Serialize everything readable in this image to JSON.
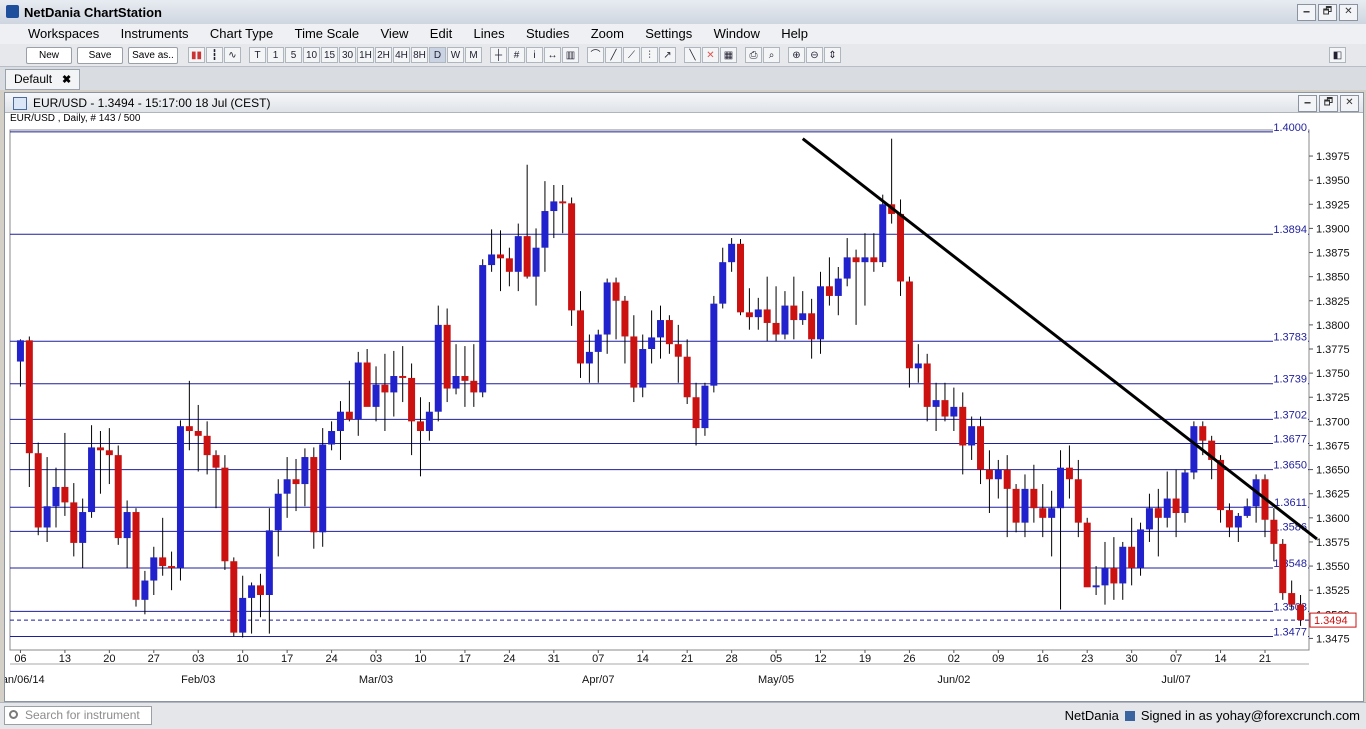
{
  "app": {
    "title": "NetDania ChartStation"
  },
  "window_buttons": [
    "🗕",
    "🗗",
    "✕"
  ],
  "menu": [
    "Workspaces",
    "Instruments",
    "Chart Type",
    "Time Scale",
    "View",
    "Edit",
    "Lines",
    "Studies",
    "Zoom",
    "Settings",
    "Window",
    "Help"
  ],
  "toolbar": {
    "new_label": "New",
    "save_label": "Save",
    "saveas_label": "Save as..",
    "timescale_buttons": [
      "T",
      "1",
      "5",
      "10",
      "15",
      "30",
      "1H",
      "2H",
      "4H",
      "8H",
      "D",
      "W",
      "M"
    ]
  },
  "tabs": [
    {
      "label": "Default",
      "close": "✖"
    }
  ],
  "chart_window": {
    "title": "EUR/USD - 1.3494 - 15:17:00  18 Jul (CEST)",
    "subtitle": "EUR/USD , Daily, # 143 / 500"
  },
  "chart_data": {
    "type": "candlestick",
    "instrument": "EUR/USD",
    "timeframe": "Daily",
    "ylim": [
      1.3463,
      1.4002
    ],
    "y_ticks": [
      1.3475,
      1.35,
      1.3525,
      1.355,
      1.3575,
      1.36,
      1.3625,
      1.365,
      1.3675,
      1.37,
      1.3725,
      1.375,
      1.3775,
      1.38,
      1.3825,
      1.385,
      1.3875,
      1.39,
      1.3925,
      1.395,
      1.3975
    ],
    "y_tick_labels": [
      "1.3475",
      "1.3500",
      "1.3525",
      "1.3550",
      "1.3575",
      "1.3600",
      "1.3625",
      "1.3650",
      "1.3675",
      "1.3700",
      "1.3725",
      "1.3750",
      "1.3775",
      "1.3800",
      "1.3825",
      "1.3850",
      "1.3875",
      "1.3900",
      "1.3925",
      "1.3950",
      "1.3975"
    ],
    "x_tick_labels": [
      "06",
      "13",
      "20",
      "27",
      "03",
      "10",
      "17",
      "24",
      "03",
      "10",
      "17",
      "24",
      "31",
      "07",
      "14",
      "21",
      "28",
      "05",
      "12",
      "19",
      "26",
      "02",
      "09",
      "16",
      "23",
      "30",
      "07",
      "14",
      "21"
    ],
    "month_labels": [
      {
        "label": "Jan/06/14",
        "week_index": 0
      },
      {
        "label": "Feb/03",
        "week_index": 4
      },
      {
        "label": "Mar/03",
        "week_index": 8
      },
      {
        "label": "Apr/07",
        "week_index": 13
      },
      {
        "label": "May/05",
        "week_index": 17
      },
      {
        "label": "Jun/02",
        "week_index": 21
      },
      {
        "label": "Jul/07",
        "week_index": 26
      }
    ],
    "horizontal_levels": [
      {
        "value": 1.4,
        "label": "1.4000"
      },
      {
        "value": 1.3894,
        "label": "1.3894"
      },
      {
        "value": 1.3783,
        "label": "1.3783"
      },
      {
        "value": 1.3739,
        "label": "1.3739"
      },
      {
        "value": 1.3702,
        "label": "1.3702"
      },
      {
        "value": 1.3677,
        "label": "1.3677"
      },
      {
        "value": 1.365,
        "label": "1.3650"
      },
      {
        "value": 1.3611,
        "label": "1.3611"
      },
      {
        "value": 1.3586,
        "label": "1.3586"
      },
      {
        "value": 1.3548,
        "label": "1.3548"
      },
      {
        "value": 1.3503,
        "label": "1.3503"
      },
      {
        "value": 1.3477,
        "label": "1.3477"
      }
    ],
    "current_price": {
      "value": 1.3494,
      "label": "1.3494"
    },
    "trendline": {
      "from": {
        "day": "2014-05-08",
        "value": 1.3993
      },
      "to": {
        "day": "2014-07-21",
        "value": 1.3578
      }
    },
    "up_color": "#2222cc",
    "down_color": "#cc1111",
    "candles": [
      [
        "Jan 06",
        1.3762,
        1.3785,
        1.3736,
        1.3784
      ],
      [
        "Jan 07",
        1.3784,
        1.3788,
        1.3632,
        1.3667
      ],
      [
        "Jan 08",
        1.3667,
        1.3678,
        1.3582,
        1.359
      ],
      [
        "Jan 09",
        1.359,
        1.3663,
        1.3575,
        1.3612
      ],
      [
        "Jan 10",
        1.3612,
        1.3652,
        1.359,
        1.3632
      ],
      [
        "Jan 13",
        1.3632,
        1.3688,
        1.3602,
        1.3616
      ],
      [
        "Jan 14",
        1.3616,
        1.3636,
        1.356,
        1.3574
      ],
      [
        "Jan 15",
        1.3574,
        1.362,
        1.3548,
        1.3606
      ],
      [
        "Jan 16",
        1.3606,
        1.3696,
        1.36,
        1.3673
      ],
      [
        "Jan 17",
        1.3673,
        1.369,
        1.3625,
        1.367
      ],
      [
        "Jan 20",
        1.367,
        1.3693,
        1.3635,
        1.3665
      ],
      [
        "Jan 21",
        1.3665,
        1.3675,
        1.3572,
        1.3579
      ],
      [
        "Jan 22",
        1.3579,
        1.3618,
        1.3548,
        1.3606
      ],
      [
        "Jan 23",
        1.3606,
        1.361,
        1.3508,
        1.3515
      ],
      [
        "Jan 24",
        1.3515,
        1.3545,
        1.35,
        1.3535
      ],
      [
        "Jan 27",
        1.3535,
        1.357,
        1.352,
        1.3559
      ],
      [
        "Jan 28",
        1.3559,
        1.36,
        1.354,
        1.355
      ],
      [
        "Jan 29",
        1.355,
        1.3565,
        1.3525,
        1.3548
      ],
      [
        "Jan 30",
        1.3548,
        1.3701,
        1.3535,
        1.3695
      ],
      [
        "Jan 31",
        1.3695,
        1.3742,
        1.367,
        1.369
      ],
      [
        "Feb 03",
        1.369,
        1.3717,
        1.3648,
        1.3685
      ],
      [
        "Feb 04",
        1.3685,
        1.37,
        1.3645,
        1.3665
      ],
      [
        "Feb 05",
        1.3665,
        1.367,
        1.361,
        1.3652
      ],
      [
        "Feb 06",
        1.3652,
        1.3665,
        1.3546,
        1.3555
      ],
      [
        "Feb 07",
        1.3555,
        1.3559,
        1.3477,
        1.3481
      ],
      [
        "Feb 10",
        1.3481,
        1.354,
        1.3476,
        1.3517
      ],
      [
        "Feb 11",
        1.3517,
        1.3533,
        1.348,
        1.353
      ],
      [
        "Feb 12",
        1.353,
        1.3542,
        1.3497,
        1.352
      ],
      [
        "Feb 13",
        1.352,
        1.361,
        1.348,
        1.3587
      ],
      [
        "Feb 14",
        1.3587,
        1.364,
        1.356,
        1.3625
      ],
      [
        "Feb 17",
        1.3625,
        1.3663,
        1.36,
        1.364
      ],
      [
        "Feb 18",
        1.364,
        1.3661,
        1.3607,
        1.3635
      ],
      [
        "Feb 19",
        1.3635,
        1.3672,
        1.3612,
        1.3663
      ],
      [
        "Feb 20",
        1.3663,
        1.3673,
        1.3568,
        1.3585
      ],
      [
        "Feb 21",
        1.3585,
        1.3693,
        1.357,
        1.3676
      ],
      [
        "Feb 24",
        1.3676,
        1.37,
        1.367,
        1.369
      ],
      [
        "Feb 25",
        1.369,
        1.3721,
        1.366,
        1.371
      ],
      [
        "Feb 26",
        1.371,
        1.3742,
        1.37,
        1.3702
      ],
      [
        "Feb 27",
        1.3702,
        1.3772,
        1.3685,
        1.3761
      ],
      [
        "Feb 28",
        1.3761,
        1.3775,
        1.3718,
        1.3715
      ],
      [
        "Mar 03",
        1.3715,
        1.3757,
        1.37,
        1.3738
      ],
      [
        "Mar 04",
        1.3738,
        1.377,
        1.369,
        1.373
      ],
      [
        "Mar 05",
        1.373,
        1.3773,
        1.3705,
        1.3747
      ],
      [
        "Mar 06",
        1.3747,
        1.3778,
        1.372,
        1.3745
      ],
      [
        "Mar 07",
        1.3745,
        1.376,
        1.3665,
        1.37
      ],
      [
        "Mar 10",
        1.37,
        1.3725,
        1.3643,
        1.369
      ],
      [
        "Mar 11",
        1.369,
        1.372,
        1.368,
        1.371
      ],
      [
        "Mar 12",
        1.371,
        1.382,
        1.37,
        1.38
      ],
      [
        "Mar 13",
        1.38,
        1.3817,
        1.372,
        1.3734
      ],
      [
        "Mar 14",
        1.3734,
        1.378,
        1.3728,
        1.3747
      ],
      [
        "Mar 17",
        1.3747,
        1.3778,
        1.3715,
        1.3742
      ],
      [
        "Mar 18",
        1.3742,
        1.378,
        1.3715,
        1.373
      ],
      [
        "Mar 19",
        1.373,
        1.3868,
        1.3725,
        1.3862
      ],
      [
        "Mar 20",
        1.3862,
        1.3899,
        1.3855,
        1.3873
      ],
      [
        "Mar 21",
        1.3873,
        1.3898,
        1.3835,
        1.3869
      ],
      [
        "Mar 24",
        1.3869,
        1.388,
        1.384,
        1.3855
      ],
      [
        "Mar 25",
        1.3855,
        1.3905,
        1.3835,
        1.3892
      ],
      [
        "Mar 26",
        1.3892,
        1.3966,
        1.3848,
        1.385
      ],
      [
        "Mar 27",
        1.385,
        1.39,
        1.382,
        1.388
      ],
      [
        "Mar 28",
        1.388,
        1.3949,
        1.3855,
        1.3918
      ],
      [
        "Mar 31",
        1.3918,
        1.3945,
        1.389,
        1.3928
      ],
      [
        "Apr 01",
        1.3928,
        1.3945,
        1.3895,
        1.3926
      ],
      [
        "Apr 02",
        1.3926,
        1.3932,
        1.3799,
        1.3815
      ],
      [
        "Apr 03",
        1.3815,
        1.3835,
        1.3745,
        1.376
      ],
      [
        "Apr 04",
        1.376,
        1.379,
        1.374,
        1.3772
      ],
      [
        "Apr 07",
        1.3772,
        1.3795,
        1.374,
        1.379
      ],
      [
        "Apr 08",
        1.379,
        1.3848,
        1.377,
        1.3844
      ],
      [
        "Apr 09",
        1.3844,
        1.3849,
        1.3785,
        1.3825
      ],
      [
        "Apr 10",
        1.3825,
        1.383,
        1.376,
        1.3788
      ],
      [
        "Apr 11",
        1.3788,
        1.381,
        1.372,
        1.3735
      ],
      [
        "Apr 14",
        1.3735,
        1.379,
        1.3725,
        1.3775
      ],
      [
        "Apr 15",
        1.3775,
        1.3815,
        1.376,
        1.3787
      ],
      [
        "Apr 16",
        1.3787,
        1.382,
        1.3765,
        1.3805
      ],
      [
        "Apr 17",
        1.3805,
        1.381,
        1.377,
        1.378
      ],
      [
        "Apr 18",
        1.378,
        1.38,
        1.374,
        1.3767
      ],
      [
        "Apr 21",
        1.3767,
        1.3785,
        1.3718,
        1.3725
      ],
      [
        "Apr 22",
        1.3725,
        1.374,
        1.3675,
        1.3693
      ],
      [
        "Apr 23",
        1.3693,
        1.374,
        1.3685,
        1.3737
      ],
      [
        "Apr 24",
        1.3737,
        1.383,
        1.373,
        1.3822
      ],
      [
        "Apr 25",
        1.3822,
        1.388,
        1.3817,
        1.3865
      ],
      [
        "Apr 28",
        1.3865,
        1.389,
        1.3855,
        1.3884
      ],
      [
        "Apr 29",
        1.3884,
        1.3889,
        1.381,
        1.3813
      ],
      [
        "Apr 30",
        1.3813,
        1.3838,
        1.3795,
        1.3808
      ],
      [
        "May 01",
        1.3808,
        1.3828,
        1.3795,
        1.3816
      ],
      [
        "May 02",
        1.3816,
        1.385,
        1.3783,
        1.3802
      ],
      [
        "May 05",
        1.3802,
        1.384,
        1.3783,
        1.379
      ],
      [
        "May 06",
        1.379,
        1.3835,
        1.3785,
        1.382
      ],
      [
        "May 07",
        1.382,
        1.385,
        1.3785,
        1.3805
      ],
      [
        "May 08",
        1.3805,
        1.3835,
        1.38,
        1.3812
      ],
      [
        "May 09",
        1.3812,
        1.3827,
        1.3765,
        1.3785
      ],
      [
        "May 12",
        1.3785,
        1.3855,
        1.377,
        1.384
      ],
      [
        "May 13",
        1.384,
        1.387,
        1.382,
        1.383
      ],
      [
        "May 14",
        1.383,
        1.386,
        1.381,
        1.3848
      ],
      [
        "May 15",
        1.3848,
        1.389,
        1.384,
        1.387
      ],
      [
        "May 16",
        1.387,
        1.3878,
        1.38,
        1.3865
      ],
      [
        "May 19",
        1.3865,
        1.3895,
        1.382,
        1.387
      ],
      [
        "May 20",
        1.387,
        1.3895,
        1.3855,
        1.3865
      ],
      [
        "May 21",
        1.3865,
        1.3935,
        1.386,
        1.3925
      ],
      [
        "May 22",
        1.3925,
        1.3993,
        1.3905,
        1.3915
      ],
      [
        "May 23",
        1.3915,
        1.393,
        1.383,
        1.3845
      ],
      [
        "May 26",
        1.3845,
        1.385,
        1.3735,
        1.3755
      ],
      [
        "May 27",
        1.3755,
        1.378,
        1.374,
        1.376
      ],
      [
        "May 28",
        1.376,
        1.377,
        1.37,
        1.3715
      ],
      [
        "May 29",
        1.3715,
        1.374,
        1.369,
        1.3722
      ],
      [
        "May 30",
        1.3722,
        1.374,
        1.37,
        1.3705
      ],
      [
        "Jun 02",
        1.3705,
        1.3735,
        1.369,
        1.3715
      ],
      [
        "Jun 03",
        1.3715,
        1.373,
        1.3645,
        1.3675
      ],
      [
        "Jun 04",
        1.3675,
        1.3705,
        1.366,
        1.3695
      ],
      [
        "Jun 05",
        1.3695,
        1.3705,
        1.3635,
        1.365
      ],
      [
        "Jun 06",
        1.365,
        1.367,
        1.3605,
        1.364
      ],
      [
        "Jun 09",
        1.364,
        1.366,
        1.362,
        1.365
      ],
      [
        "Jun 10",
        1.365,
        1.3665,
        1.358,
        1.363
      ],
      [
        "Jun 11",
        1.363,
        1.3635,
        1.3585,
        1.3595
      ],
      [
        "Jun 12",
        1.3595,
        1.3645,
        1.358,
        1.363
      ],
      [
        "Jun 13",
        1.363,
        1.3655,
        1.3595,
        1.361
      ],
      [
        "Jun 16",
        1.361,
        1.3635,
        1.358,
        1.36
      ],
      [
        "Jun 17",
        1.36,
        1.3628,
        1.356,
        1.361
      ],
      [
        "Jun 18",
        1.361,
        1.367,
        1.3505,
        1.3652
      ],
      [
        "Jun 19",
        1.3652,
        1.3675,
        1.362,
        1.364
      ],
      [
        "Jun 20",
        1.364,
        1.366,
        1.358,
        1.3595
      ],
      [
        "Jun 23",
        1.3595,
        1.36,
        1.354,
        1.3528
      ],
      [
        "Jun 24",
        1.3528,
        1.355,
        1.352,
        1.353
      ],
      [
        "Jun 25",
        1.353,
        1.3575,
        1.351,
        1.3548
      ],
      [
        "Jun 26",
        1.3548,
        1.358,
        1.3515,
        1.3532
      ],
      [
        "Jun 27",
        1.3532,
        1.3575,
        1.3515,
        1.357
      ],
      [
        "Jun 30",
        1.357,
        1.36,
        1.353,
        1.3548
      ],
      [
        "Jul 01",
        1.3548,
        1.3595,
        1.354,
        1.3588
      ],
      [
        "Jul 02",
        1.3588,
        1.3625,
        1.3575,
        1.361
      ],
      [
        "Jul 03",
        1.361,
        1.363,
        1.356,
        1.36
      ],
      [
        "Jul 04",
        1.36,
        1.3648,
        1.359,
        1.362
      ],
      [
        "Jul 07",
        1.362,
        1.365,
        1.358,
        1.3605
      ],
      [
        "Jul 08",
        1.3605,
        1.365,
        1.3595,
        1.3647
      ],
      [
        "Jul 09",
        1.3647,
        1.37,
        1.364,
        1.3695
      ],
      [
        "Jul 10",
        1.3695,
        1.37,
        1.3665,
        1.368
      ],
      [
        "Jul 11",
        1.368,
        1.3685,
        1.364,
        1.366
      ],
      [
        "Jul 14",
        1.366,
        1.3665,
        1.3595,
        1.3608
      ],
      [
        "Jul 15",
        1.3608,
        1.3615,
        1.358,
        1.359
      ],
      [
        "Jul 16",
        1.359,
        1.3605,
        1.3575,
        1.3602
      ],
      [
        "Jul 17",
        1.3602,
        1.362,
        1.36,
        1.3612
      ],
      [
        "Jul 18",
        1.3612,
        1.3645,
        1.3595,
        1.364
      ],
      [
        "Jul 21",
        1.364,
        1.3645,
        1.358,
        1.3598
      ],
      [
        "Jul 22",
        1.3598,
        1.361,
        1.3555,
        1.3573
      ],
      [
        "Jul 23",
        1.3573,
        1.3578,
        1.3515,
        1.3522
      ],
      [
        "Jul 24",
        1.3522,
        1.3535,
        1.3505,
        1.351
      ],
      [
        "Jul 25",
        1.351,
        1.352,
        1.3488,
        1.3494
      ]
    ]
  },
  "status": {
    "search_placeholder": "Search for instrument",
    "provider": "NetDania",
    "signed_in": "Signed in as yohay@forexcrunch.com"
  }
}
